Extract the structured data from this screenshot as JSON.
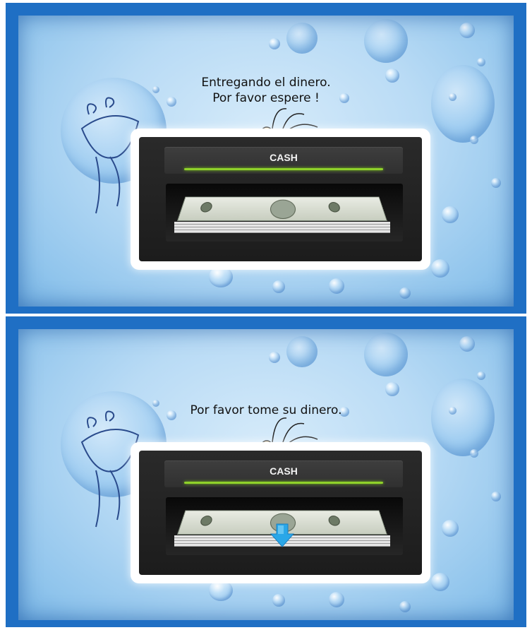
{
  "screens": [
    {
      "message_lines": [
        "Entregando el dinero.",
        "Por favor espere !"
      ],
      "panel": {
        "label": "CASH"
      },
      "arrow_visible": false
    },
    {
      "message_lines": [
        "Por favor tome su dinero."
      ],
      "panel": {
        "label": "CASH"
      },
      "arrow_visible": true
    }
  ],
  "colors": {
    "frame_blue": "#1f6fc4",
    "progress_green": "#8fd12a",
    "arrow_blue": "#2aa7e8"
  },
  "icons": [
    "cash-note-icon",
    "down-arrow-icon",
    "bubble-doodle"
  ]
}
